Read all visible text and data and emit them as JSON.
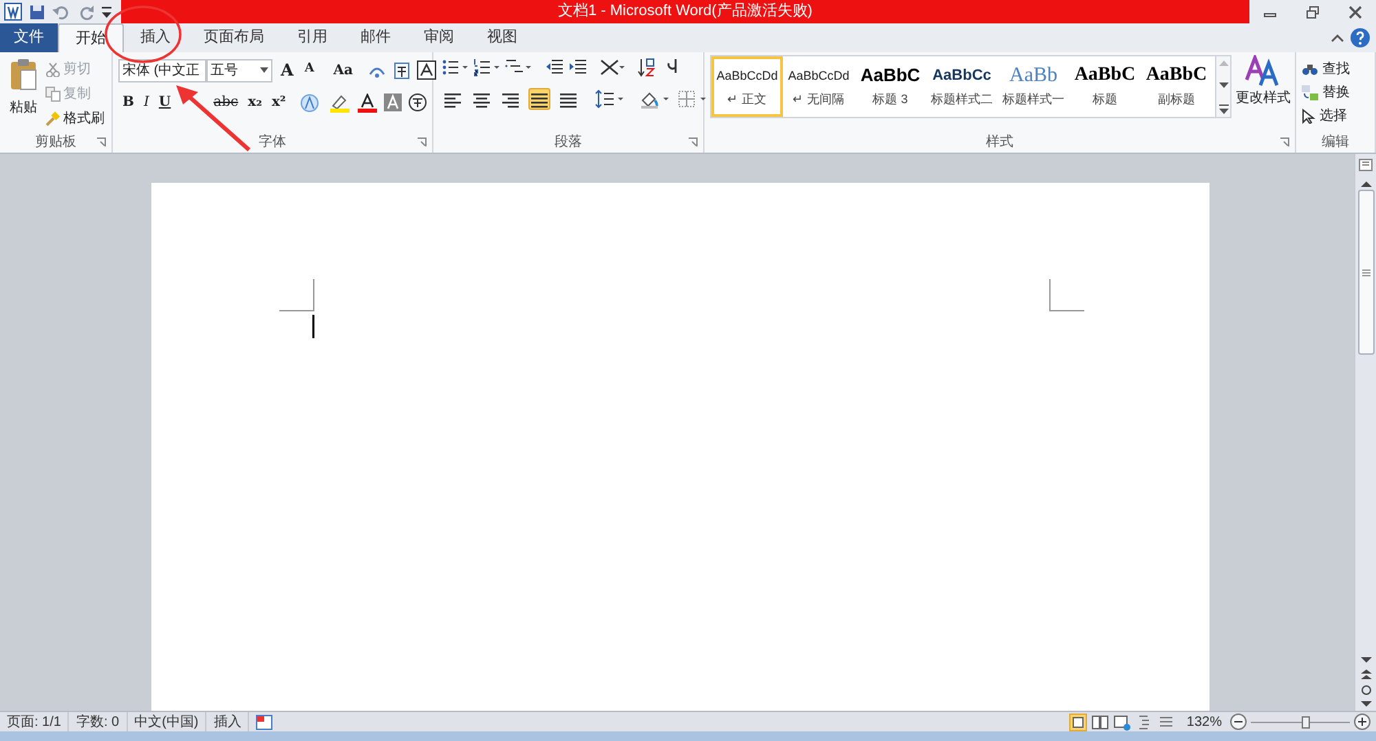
{
  "title_bar": {
    "title": "文档1 - Microsoft Word(产品激活失败)"
  },
  "tabs": [
    {
      "label": "文件",
      "kind": "file",
      "selected": false
    },
    {
      "label": "开始",
      "kind": "tab",
      "selected": true
    },
    {
      "label": "插入",
      "kind": "tab",
      "selected": false
    },
    {
      "label": "页面布局",
      "kind": "tab",
      "selected": false
    },
    {
      "label": "引用",
      "kind": "tab",
      "selected": false
    },
    {
      "label": "邮件",
      "kind": "tab",
      "selected": false
    },
    {
      "label": "审阅",
      "kind": "tab",
      "selected": false
    },
    {
      "label": "视图",
      "kind": "tab",
      "selected": false
    }
  ],
  "clipboard": {
    "group_label": "剪贴板",
    "paste": "粘贴",
    "items": [
      {
        "label": "剪切",
        "kind": "cut",
        "disabled": true
      },
      {
        "label": "复制",
        "kind": "copy",
        "disabled": true
      },
      {
        "label": "格式刷",
        "kind": "brush",
        "disabled": false
      }
    ]
  },
  "font": {
    "group_label": "字体",
    "name": "宋体 (中文正",
    "size": "五号",
    "row1": [
      {
        "label": "A",
        "kind": "grow"
      },
      {
        "label": "A",
        "kind": "shrink"
      },
      {
        "label": "Aa",
        "kind": "case"
      }
    ],
    "row2": [
      {
        "label": "B",
        "kind": "bold"
      },
      {
        "label": "I",
        "kind": "italic"
      },
      {
        "label": "U",
        "kind": "underline"
      },
      {
        "label": "abc",
        "kind": "strike"
      },
      {
        "label": "x₂",
        "kind": "sub"
      },
      {
        "label": "x²",
        "kind": "sup"
      }
    ]
  },
  "paragraph": {
    "group_label": "段落",
    "align": [
      {
        "kind": "left",
        "selected": false
      },
      {
        "kind": "center",
        "selected": false
      },
      {
        "kind": "right",
        "selected": false
      },
      {
        "kind": "justify",
        "selected": true
      },
      {
        "kind": "distributed",
        "selected": false
      }
    ]
  },
  "styles": {
    "group_label": "样式",
    "items": [
      {
        "preview": "AaBbCcDd",
        "label": "↵ 正文",
        "kind": "body",
        "selected": true
      },
      {
        "preview": "AaBbCcDd",
        "label": "↵ 无间隔",
        "kind": "body",
        "selected": false
      },
      {
        "preview": "AaBbC",
        "label": "标题 3",
        "kind": "heading",
        "selected": false
      },
      {
        "preview": "AaBbCc",
        "label": "标题样式二",
        "kind": "heading2",
        "selected": false
      },
      {
        "preview": "AaBb",
        "label": "标题样式一",
        "kind": "light",
        "selected": false
      },
      {
        "preview": "AaBbC",
        "label": "标题",
        "kind": "title",
        "selected": false
      },
      {
        "preview": "AaBbC",
        "label": "副标题",
        "kind": "title",
        "selected": false
      }
    ],
    "change": "更改样式"
  },
  "editing": {
    "group_label": "编辑",
    "items": [
      {
        "label": "查找",
        "kind": "find"
      },
      {
        "label": "替换",
        "kind": "replace"
      },
      {
        "label": "选择",
        "kind": "select"
      }
    ]
  },
  "status_bar": {
    "items": [
      "页面: 1/1",
      "字数: 0",
      "中文(中国)",
      "插入"
    ],
    "zoom": "132%",
    "zoom_slider": {
      "level": 0.55
    }
  }
}
